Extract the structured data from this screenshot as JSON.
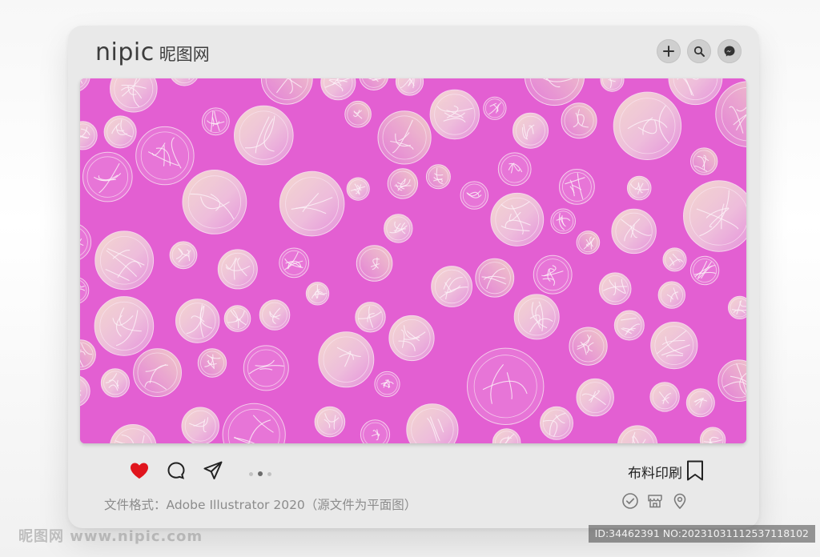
{
  "brand": {
    "name_en": "nipic",
    "name_cn": "昵图网"
  },
  "top_icons": [
    "plus-icon",
    "search-icon",
    "messenger-icon"
  ],
  "artwork": {
    "description_colors": {
      "background": "#e35fd2",
      "circle_light": "#f3d9c4",
      "circle_mid": "#e69bdc",
      "line": "#fbe9f4"
    }
  },
  "actions": [
    "heart-icon",
    "comment-icon",
    "share-icon"
  ],
  "pager": {
    "count": 3,
    "active": 2
  },
  "category_label": "布料印刷",
  "format_text": "文件格式：Adobe Illustrator 2020（源文件为平面图）",
  "bottom_icons": [
    "check-circle-icon",
    "store-icon",
    "location-pin-icon"
  ],
  "watermark": {
    "left": "昵图网 www.nipic.com",
    "right": "ID:34462391 NO:20231031112537118102"
  },
  "colors": {
    "heart": "#e0151d",
    "card": "#e9e9e9",
    "brand_text": "#3d3d3d"
  }
}
